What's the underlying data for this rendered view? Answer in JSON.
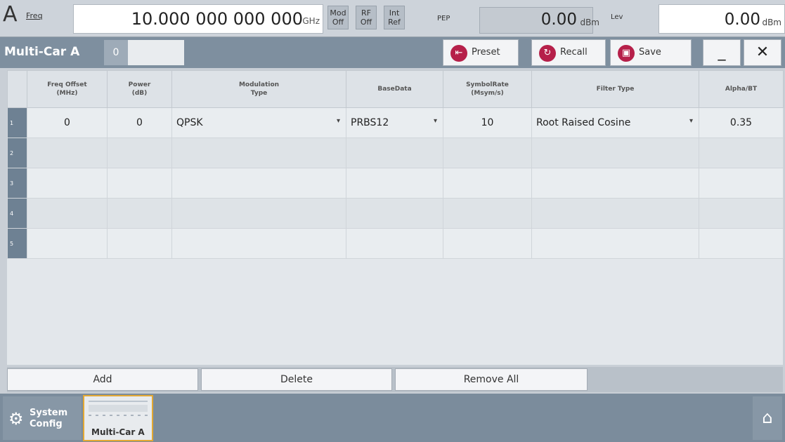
{
  "header": {
    "mode_letter": "A",
    "freq_label": "Freq",
    "freq_value": "10.000 000 000 000",
    "freq_unit": "GHz",
    "tags": [
      {
        "top": "Mod",
        "bottom": "Off"
      },
      {
        "top": "RF",
        "bottom": "Off"
      },
      {
        "top": "Int",
        "bottom": "Ref"
      }
    ],
    "pep_label": "PEP",
    "pep_value": "0.00",
    "pep_unit": "dBm",
    "lev_label": "Lev",
    "lev_value": "0.00",
    "lev_unit": "dBm"
  },
  "titlebar": {
    "title": "Multi-Car A",
    "tab_index": "0",
    "preset_label": "Preset",
    "recall_label": "Recall",
    "save_label": "Save",
    "minimize_glyph": "_",
    "close_glyph": "✕"
  },
  "table": {
    "columns": [
      "Freq Offset\n(MHz)",
      "Power\n(dB)",
      "Modulation\nType",
      "BaseData",
      "SymbolRate\n(Msym/s)",
      "Filter Type",
      "Alpha/BT"
    ],
    "rows": [
      {
        "index": "1",
        "freq_offset": "0",
        "power": "0",
        "modulation": "QPSK",
        "basedata": "PRBS12",
        "symbolrate": "10",
        "filter": "Root Raised Cosine",
        "alpha": "0.35"
      },
      {
        "index": "2",
        "freq_offset": "",
        "power": "",
        "modulation": "",
        "basedata": "",
        "symbolrate": "",
        "filter": "",
        "alpha": ""
      },
      {
        "index": "3",
        "freq_offset": "",
        "power": "",
        "modulation": "",
        "basedata": "",
        "symbolrate": "",
        "filter": "",
        "alpha": ""
      },
      {
        "index": "4",
        "freq_offset": "",
        "power": "",
        "modulation": "",
        "basedata": "",
        "symbolrate": "",
        "filter": "",
        "alpha": ""
      },
      {
        "index": "5",
        "freq_offset": "",
        "power": "",
        "modulation": "",
        "basedata": "",
        "symbolrate": "",
        "filter": "",
        "alpha": ""
      }
    ]
  },
  "actions": {
    "add": "Add",
    "delete": "Delete",
    "remove_all": "Remove All"
  },
  "taskbar": {
    "system_line1": "System",
    "system_line2": "Config",
    "thumb_label": "Multi-Car A"
  }
}
